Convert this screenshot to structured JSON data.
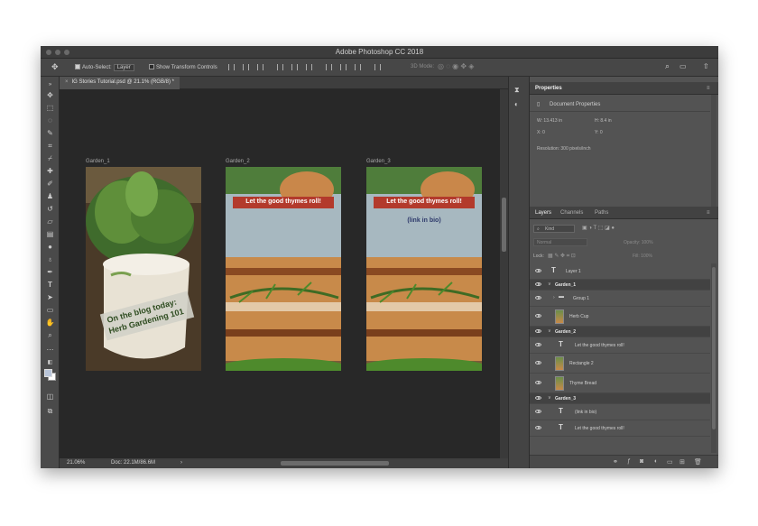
{
  "window": {
    "title": "Adobe Photoshop CC 2018"
  },
  "options": {
    "auto_select_label": "Auto-Select:",
    "auto_select_value": "Layer",
    "transform_label": "Show Transform Controls",
    "mode_3d_label": "3D Mode:"
  },
  "document": {
    "tab_title": "IG Stories Tutorial.psd @ 21.1% (RGB/8) *"
  },
  "status": {
    "zoom": "21.06%",
    "doc_size": "Doc: 22.1M/86.6M"
  },
  "artboards": [
    {
      "label": "Garden_1",
      "overlay_line1": "On the blog today:",
      "overlay_line2": "Herb Gardening 101"
    },
    {
      "label": "Garden_2",
      "banner": "Let the good thymes roll!"
    },
    {
      "label": "Garden_3",
      "banner": "Let the good thymes roll!",
      "sub": "(link in bio)"
    }
  ],
  "properties": {
    "tab": "Properties",
    "section": "Document Properties",
    "w": "W: 13.413 in",
    "h": "H: 8.4 in",
    "x": "X: 0",
    "y": "Y: 0",
    "resolution": "Resolution: 300 pixels/inch"
  },
  "layers_panel": {
    "tabs": [
      "Layers",
      "Channels",
      "Paths"
    ],
    "filter": "Kind",
    "blend": "Normal",
    "opacity": "Opacity: 100%",
    "lock": "Lock:",
    "fill": "Fill: 100%",
    "rows": [
      {
        "type": "text",
        "name": "Layer 1"
      },
      {
        "type": "group",
        "name": "Garden_1"
      },
      {
        "type": "folder",
        "name": "Group 1"
      },
      {
        "type": "image",
        "name": "Herb Cup"
      },
      {
        "type": "group",
        "name": "Garden_2"
      },
      {
        "type": "text",
        "name": "Let the good thymes roll!"
      },
      {
        "type": "image",
        "name": "Rectangle 2"
      },
      {
        "type": "image",
        "name": "Thyme Bread"
      },
      {
        "type": "group",
        "name": "Garden_3"
      },
      {
        "type": "text",
        "name": "(link in bio)"
      },
      {
        "type": "text",
        "name": "Let the good thymes roll!"
      }
    ]
  },
  "colors": {
    "accent_red": "#b33a2c",
    "panel_bg": "#535353",
    "canvas_bg": "#282828"
  }
}
